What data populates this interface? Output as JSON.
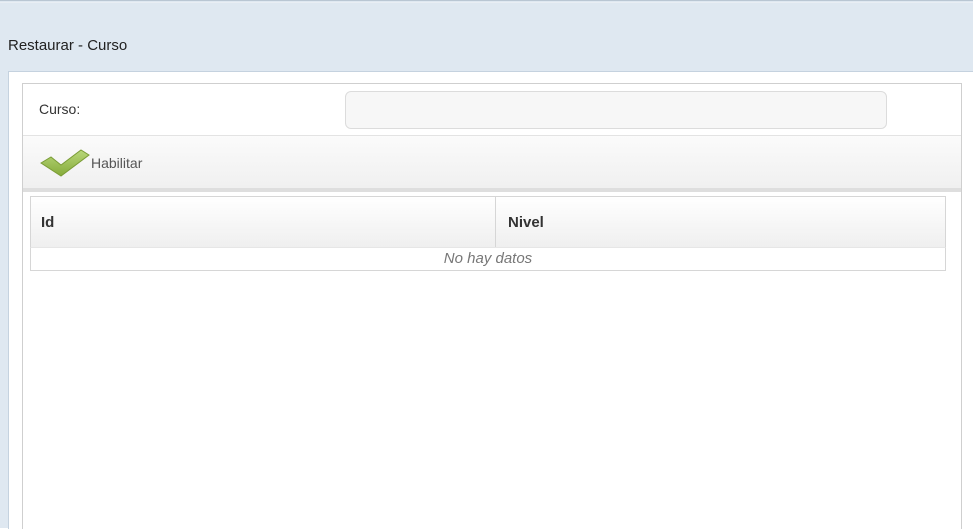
{
  "window": {
    "title": "Restaurar - Curso"
  },
  "form": {
    "curso_label": "Curso:",
    "curso_value": "",
    "curso_placeholder": ""
  },
  "toolbar": {
    "habilitar_label": "Habilitar",
    "habilitar_icon": "check-icon"
  },
  "grid": {
    "columns": [
      "Id",
      "Nivel"
    ],
    "rows": [],
    "empty_text": "No hay datos"
  },
  "colors": {
    "titlebar": "#dfe8f1",
    "check_green": "#9bc14b"
  }
}
